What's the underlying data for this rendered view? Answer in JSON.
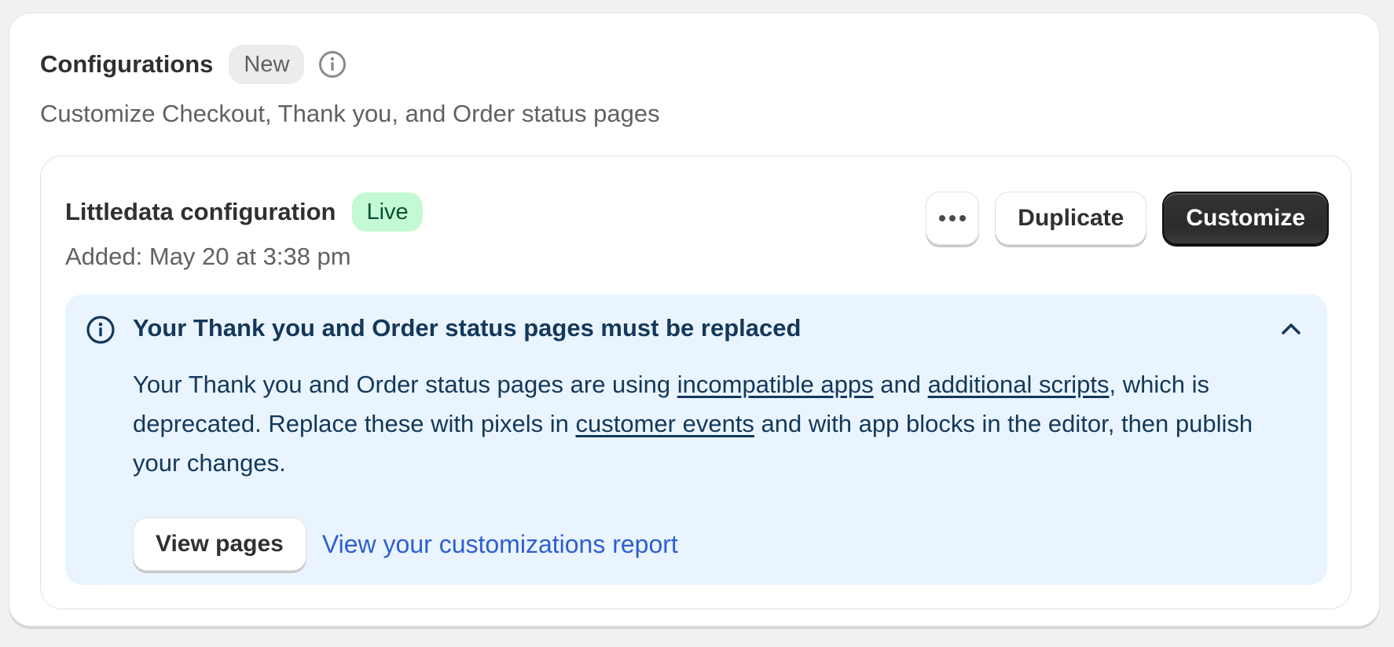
{
  "section": {
    "title": "Configurations",
    "badge": "New",
    "info_icon": "info-icon",
    "subtitle": "Customize Checkout, Thank you, and Order status pages"
  },
  "configuration": {
    "name": "Littledata configuration",
    "status_badge": "Live",
    "added": "Added: May 20 at 3:38 pm",
    "actions": {
      "more_icon": "more-horizontal-icon",
      "duplicate_label": "Duplicate",
      "customize_label": "Customize"
    }
  },
  "banner": {
    "icon": "info-icon",
    "title": "Your Thank you and Order status pages must be replaced",
    "collapse_icon": "chevron-up-icon",
    "body": {
      "part1": "Your Thank you and Order status pages are using ",
      "link1": "incompatible apps",
      "part2": " and ",
      "link2": "additional scripts",
      "part3": ", which is deprecated. Replace these with pixels in ",
      "link3": "customer events",
      "part4": " and with app blocks in the editor, then publish your changes."
    },
    "primary_action": "View pages",
    "secondary_link": "View your customizations report"
  },
  "colors": {
    "live_badge_bg": "#c3f9d5",
    "banner_bg": "#eaf4ff",
    "banner_text": "#13385a",
    "link": "#2c5fd0",
    "primary_button": "#303030"
  }
}
